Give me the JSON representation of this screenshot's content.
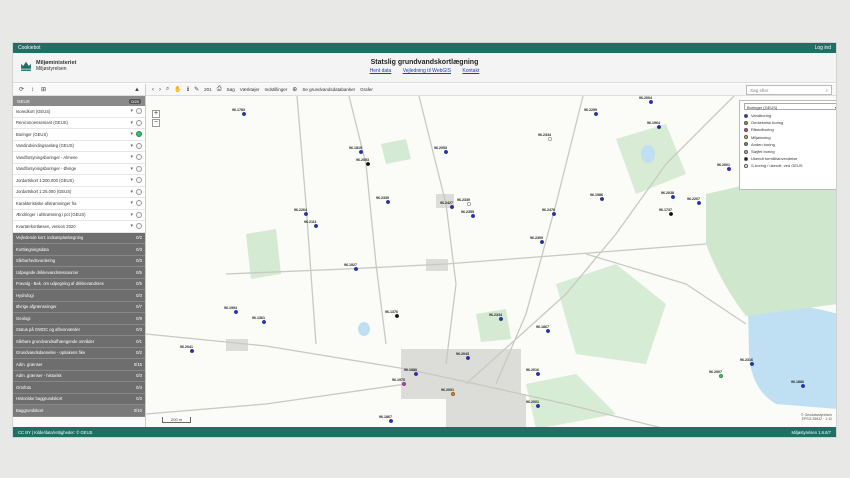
{
  "topbar": {
    "left": "Cookiebot",
    "right": "Log ind"
  },
  "header": {
    "org_name": "Miljøministeriet",
    "org_sub": "Miljøstyrelsen",
    "title": "Statslig grundvandskortlægning",
    "links": [
      "Hent data",
      "Vejledning til WebGIS",
      "Kontakt"
    ]
  },
  "sidebar": {
    "group_header": {
      "label": "GEUS",
      "count": "0/20"
    },
    "layers": [
      {
        "label": "Isoredkort (GEUS)",
        "active": false
      },
      {
        "label": "Reniconoensemant (GEUS)",
        "active": false
      },
      {
        "label": "Boringer (GEUS)",
        "active": true
      },
      {
        "label": "Vandindvindingsanlæg (GEUS)",
        "active": false
      },
      {
        "label": "Vandforsyningsboringer - Almene",
        "active": false
      },
      {
        "label": "Vandforsyningsboringer - Øvrige",
        "active": false
      },
      {
        "label": "Jordartskort 1:200.000 (GEUS)",
        "active": false
      },
      {
        "label": "Jordartskort 1:25.000 (GEUS)",
        "active": false
      },
      {
        "label": "Karakteristiske afstrømninger fra",
        "active": false
      },
      {
        "label": "Ændringer i afstrømning i pct (GEUS)",
        "active": false
      },
      {
        "label": "Kvartærkortlæsen, version 2020",
        "active": false
      }
    ],
    "groups": [
      {
        "label": "Vejledende kort: indsatsplanlægning",
        "count": "0/2"
      },
      {
        "label": "Kortlægningsdata",
        "count": "0/3"
      },
      {
        "label": "Sårbarhedsvurdering",
        "count": "0/3"
      },
      {
        "label": "Udpegede drikkevandsressourcer",
        "count": "0/5"
      },
      {
        "label": "Fravalg - Bek. om udpegning af drikkevandsres",
        "count": "0/5"
      },
      {
        "label": "Hydrologi",
        "count": "0/3"
      },
      {
        "label": "Øvrige afgrænsninger",
        "count": "0/7"
      },
      {
        "label": "Geologi",
        "count": "0/9"
      },
      {
        "label": "Status på GWDC og afhvorværder",
        "count": "0/3"
      },
      {
        "label": "Sårbare grundvandsafhængende områder",
        "count": "0/1"
      },
      {
        "label": "Grundvandsdannelse - optiakens fike",
        "count": "0/2"
      },
      {
        "label": "Adm. grænser",
        "count": "0/15"
      },
      {
        "label": "Adm. grænser - historisk",
        "count": "0/3"
      },
      {
        "label": "Ortofoto",
        "count": "0/4"
      },
      {
        "label": "Historiske baggrundskort",
        "count": "0/3"
      },
      {
        "label": "Baggrundskort",
        "count": "0/10"
      }
    ]
  },
  "map_toolbar": {
    "count_label": "201",
    "menus": [
      "Søg",
      "Værktøjer",
      "Indstillinger"
    ],
    "extra": [
      "Se grundvandsdatabanker",
      "Grafer"
    ],
    "search_placeholder": "Søg efter"
  },
  "legend": {
    "selected": "Boringer (GEUS)",
    "items": [
      {
        "label": "Vandboring",
        "color": "#1f2fd6"
      },
      {
        "label": "Geoteknisk boring",
        "color": "#e07b1a"
      },
      {
        "label": "Råstofboring",
        "color": "#c23ac4"
      },
      {
        "label": "Miljøboring",
        "color": "#d6c21a"
      },
      {
        "label": "Anden boring",
        "color": "#2ec463"
      },
      {
        "label": "Sløjfet boring",
        "color": "#bbbbbb"
      },
      {
        "label": "Ukendt formål/anvendelse",
        "color": "#111111"
      },
      {
        "label": "S-boring / ukendt, ved GEUS",
        "color": "#ffffff"
      }
    ]
  },
  "scale_label": "200 m",
  "attribution": [
    "© Geodatastyrelsen",
    "EPSG:25832 · 1:12"
  ],
  "markers": [
    {
      "label": "96.1783"
    },
    {
      "label": "96.1815"
    },
    {
      "label": "96.2053"
    },
    {
      "label": "96.2053"
    },
    {
      "label": "96.2339"
    },
    {
      "label": "96.2264"
    },
    {
      "label": "96.2355"
    },
    {
      "label": "96.2339"
    },
    {
      "label": "96.2004"
    },
    {
      "label": "96.1964"
    },
    {
      "label": "96.2334"
    },
    {
      "label": "96.2259"
    },
    {
      "label": "96.2038"
    },
    {
      "label": "96.2207"
    },
    {
      "label": "96.1737"
    },
    {
      "label": "96.2001"
    },
    {
      "label": "96.2111"
    },
    {
      "label": "96.2427"
    },
    {
      "label": "96.2476"
    },
    {
      "label": "96.2309"
    },
    {
      "label": "96.1986"
    },
    {
      "label": "96.1927"
    },
    {
      "label": "96.2334"
    },
    {
      "label": "96.1867"
    },
    {
      "label": "96.1361"
    },
    {
      "label": "96.1994"
    },
    {
      "label": "96.1376"
    },
    {
      "label": "96.2041"
    },
    {
      "label": "96.2043"
    },
    {
      "label": "96.2016"
    },
    {
      "label": "96.2001"
    },
    {
      "label": "96.1980"
    },
    {
      "label": "96.1970"
    },
    {
      "label": "96.2007"
    },
    {
      "label": "96.2316"
    },
    {
      "label": "96.1886"
    },
    {
      "label": "96.2001"
    },
    {
      "label": "96.1867"
    }
  ],
  "footer": {
    "left": "CC BY | Kilde/data/rettigheder: © GEUS",
    "right": "Miljøstyrelsen 1.6.6/7"
  }
}
